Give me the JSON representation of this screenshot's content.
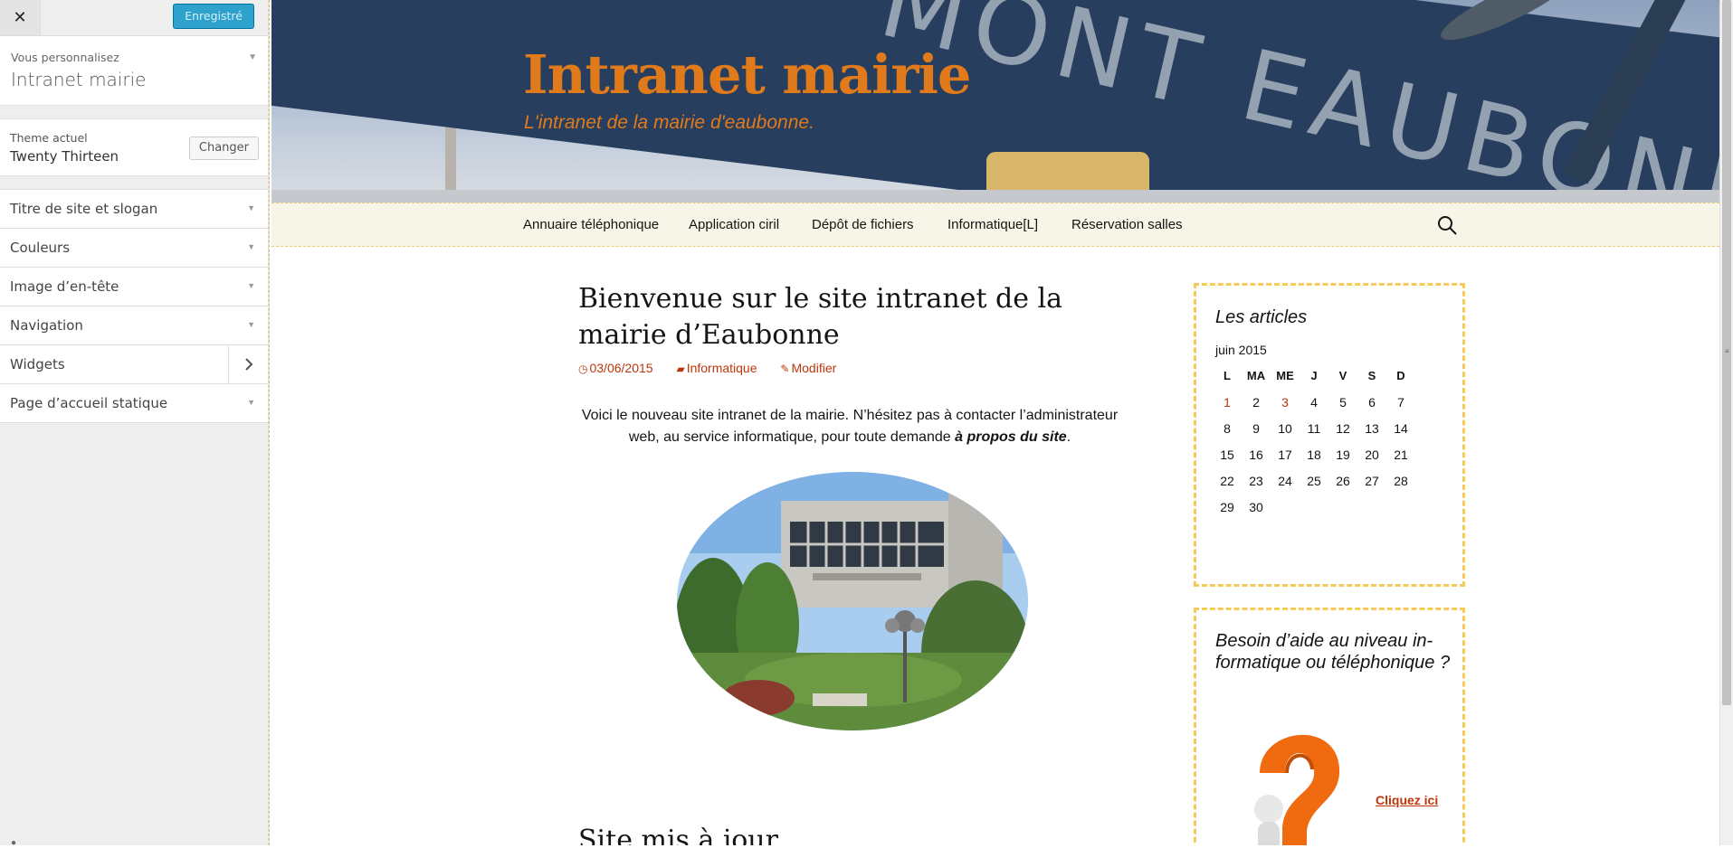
{
  "customizer": {
    "close_glyph": "✕",
    "save_label": "Enregistré",
    "customizing_label": "Vous personnalisez",
    "site_name": "Intranet mairie",
    "theme_label": "Theme actuel",
    "theme_name": "Twenty Thirteen",
    "change_label": "Changer",
    "sections": [
      {
        "label": "Titre de site et slogan"
      },
      {
        "label": "Couleurs"
      },
      {
        "label": "Image d’en-tête"
      },
      {
        "label": "Navigation"
      },
      {
        "label": "Widgets"
      },
      {
        "label": "Page d’accueil statique"
      }
    ]
  },
  "site": {
    "title": "Intranet mairie",
    "tagline": "L'intranet de la mairie d'eaubonne.",
    "header_sign_text": "MONT EAUBONNE",
    "accent_color": "#e17a1b",
    "link_color": "#bc360a",
    "nav": [
      {
        "label": "Annuaire téléphonique"
      },
      {
        "label": "Application ciril"
      },
      {
        "label": "Dépôt de fichiers"
      },
      {
        "label": "Informatique[L]"
      },
      {
        "label": "Réservation salles"
      }
    ]
  },
  "post": {
    "title": "Bienvenue sur le site intranet de la mairie d’Eaubonne",
    "date": "03/06/2015",
    "category": "Informatique",
    "edit": "Modifier",
    "body_text": "Voici le nouveau site intranet de la mairie. N’hésitez pas à contacter l’administrateur web, au service informatique, pour toute demande",
    "body_emph": "à propos du site",
    "body_end": ".",
    "next_title": "Site mis à jour"
  },
  "widgets": {
    "calendar": {
      "title": "Les articles",
      "caption": "juin 2015",
      "days": [
        "L",
        "MA",
        "ME",
        "J",
        "V",
        "S",
        "D"
      ],
      "weeks": [
        [
          "1",
          "2",
          "3",
          "4",
          "5",
          "6",
          "7"
        ],
        [
          "8",
          "9",
          "10",
          "11",
          "12",
          "13",
          "14"
        ],
        [
          "15",
          "16",
          "17",
          "18",
          "19",
          "20",
          "21"
        ],
        [
          "22",
          "23",
          "24",
          "25",
          "26",
          "27",
          "28"
        ],
        [
          "29",
          "30",
          "",
          "",
          "",
          "",
          ""
        ]
      ],
      "linked_days": [
        "1",
        "3"
      ]
    },
    "help": {
      "title": "Besoin d’aide au niveau in-formatique ou téléphonique ?",
      "link_label": "Cliquez ici"
    }
  }
}
